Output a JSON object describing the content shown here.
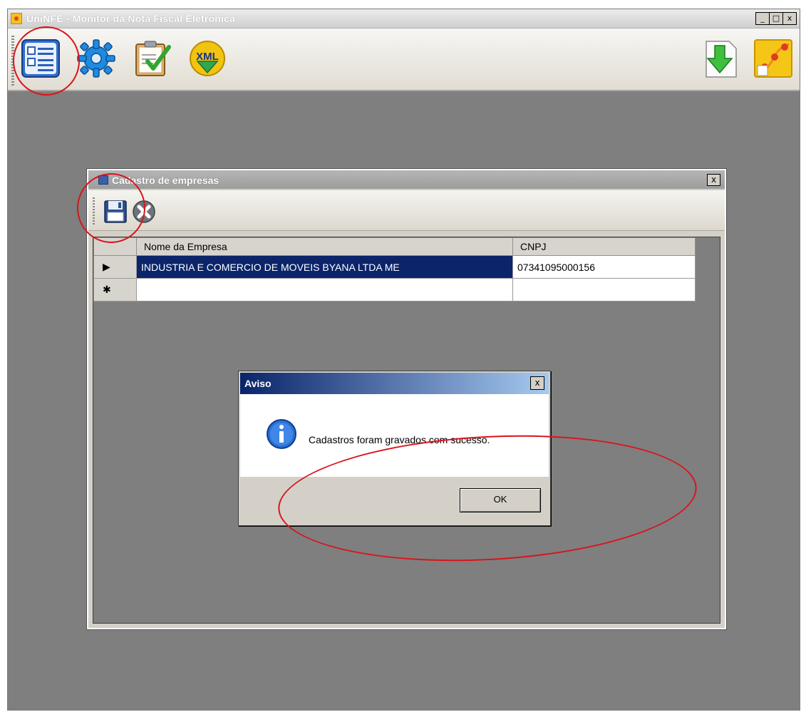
{
  "main_window": {
    "title": "UniNFE - Monitor da Nota Fiscal Eletrônica",
    "window_buttons": [
      "_",
      "□",
      "x"
    ],
    "toolbar": {
      "left_buttons": [
        {
          "icon": "company-registry-icon"
        },
        {
          "icon": "gear-icon"
        },
        {
          "icon": "checklist-icon"
        },
        {
          "icon": "xml-icon",
          "label": "XML"
        }
      ],
      "right_buttons": [
        {
          "icon": "download-arrow-icon"
        },
        {
          "icon": "uninfe-logo-icon"
        }
      ]
    }
  },
  "child_window": {
    "title": "Cadastro de empresas",
    "close": "x",
    "toolbar": {
      "buttons": [
        {
          "icon": "save-floppy-icon"
        },
        {
          "icon": "cancel-x-icon"
        }
      ]
    },
    "grid": {
      "columns": [
        "Nome da Empresa",
        "CNPJ"
      ],
      "rows": [
        {
          "indicator": "▶",
          "name": "INDUSTRIA E COMERCIO DE MOVEIS BYANA LTDA ME",
          "cnpj": "07341095000156"
        },
        {
          "indicator": "✱",
          "name": "",
          "cnpj": ""
        }
      ]
    }
  },
  "dialog": {
    "title": "Aviso",
    "close": "x",
    "message": "Cadastros foram gravados com sucesso.",
    "icon": "info-icon",
    "ok_label": "OK"
  },
  "colors": {
    "selection": "#0b246a",
    "annotation": "#d9141c",
    "mdi_background": "#7f7f7f"
  }
}
